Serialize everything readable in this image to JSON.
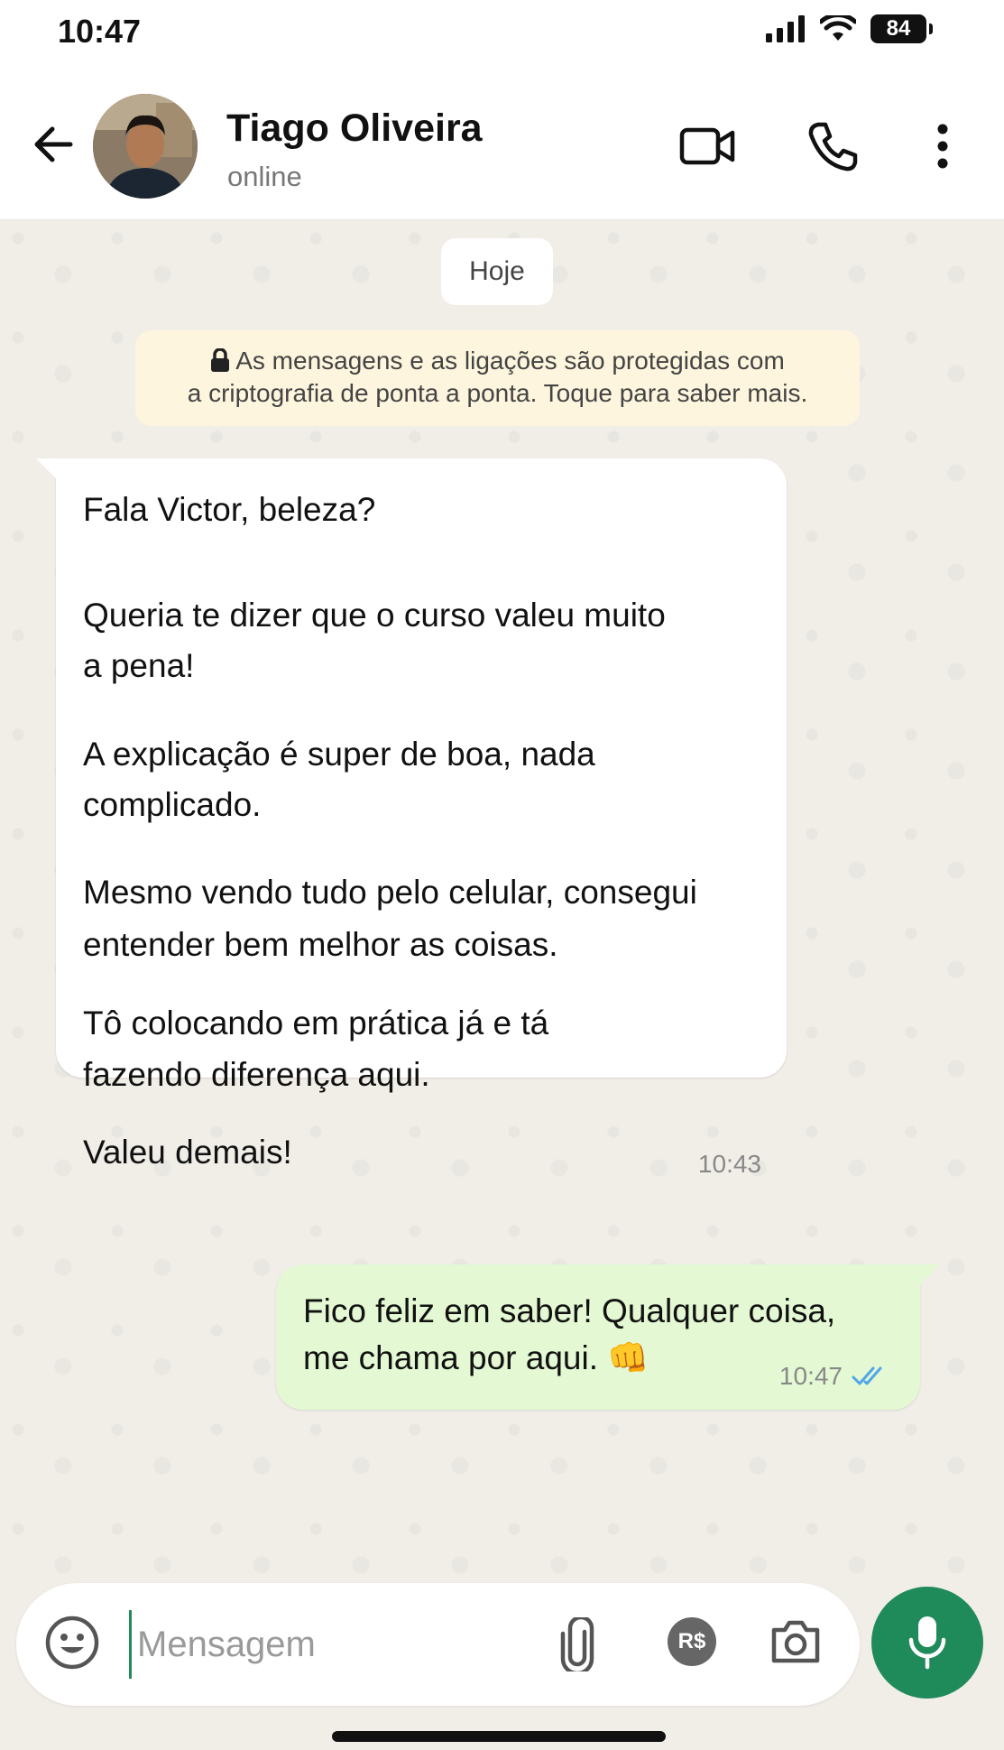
{
  "status_bar": {
    "time": "10:47",
    "battery": "84"
  },
  "header": {
    "contact_name": "Tiago Oliveira",
    "contact_status": "online",
    "icons": [
      "back-arrow-icon",
      "video-call-icon",
      "phone-call-icon",
      "more-options-icon"
    ]
  },
  "chat": {
    "day_label": "Hoje",
    "encryption_notice": {
      "line1": "As mensagens e as ligações são protegidas com",
      "line2": "a criptografia de ponta a ponta. Toque para saber mais."
    },
    "messages": [
      {
        "direction": "incoming",
        "lines": [
          "Fala Victor, beleza?",
          "Queria te dizer que o curso valeu muito",
          "a pena!",
          "A explicação é super de boa, nada",
          "complicado.",
          "Mesmo vendo tudo pelo celular, consegui",
          "entender bem melhor as coisas.",
          "Tô colocando em prática já e tá",
          "fazendo diferença aqui.",
          "Valeu demais!"
        ],
        "time": "10:43"
      },
      {
        "direction": "outgoing",
        "lines": [
          "Fico feliz em saber! Qualquer coisa,",
          "me chama por aqui. 👊"
        ],
        "time": "10:47",
        "read_status": "double-check-read"
      }
    ]
  },
  "composer": {
    "placeholder": "Mensagem",
    "icons": [
      "emoji-icon",
      "attachment-icon",
      "payment-icon",
      "camera-icon",
      "microphone-icon"
    ],
    "payment_label": "R$"
  },
  "colors": {
    "accent_green": "#1f8a5a",
    "outgoing_bubble": "#e3f8d3",
    "chat_background": "#f1eee8",
    "read_tick_blue": "#4fa6e8"
  }
}
